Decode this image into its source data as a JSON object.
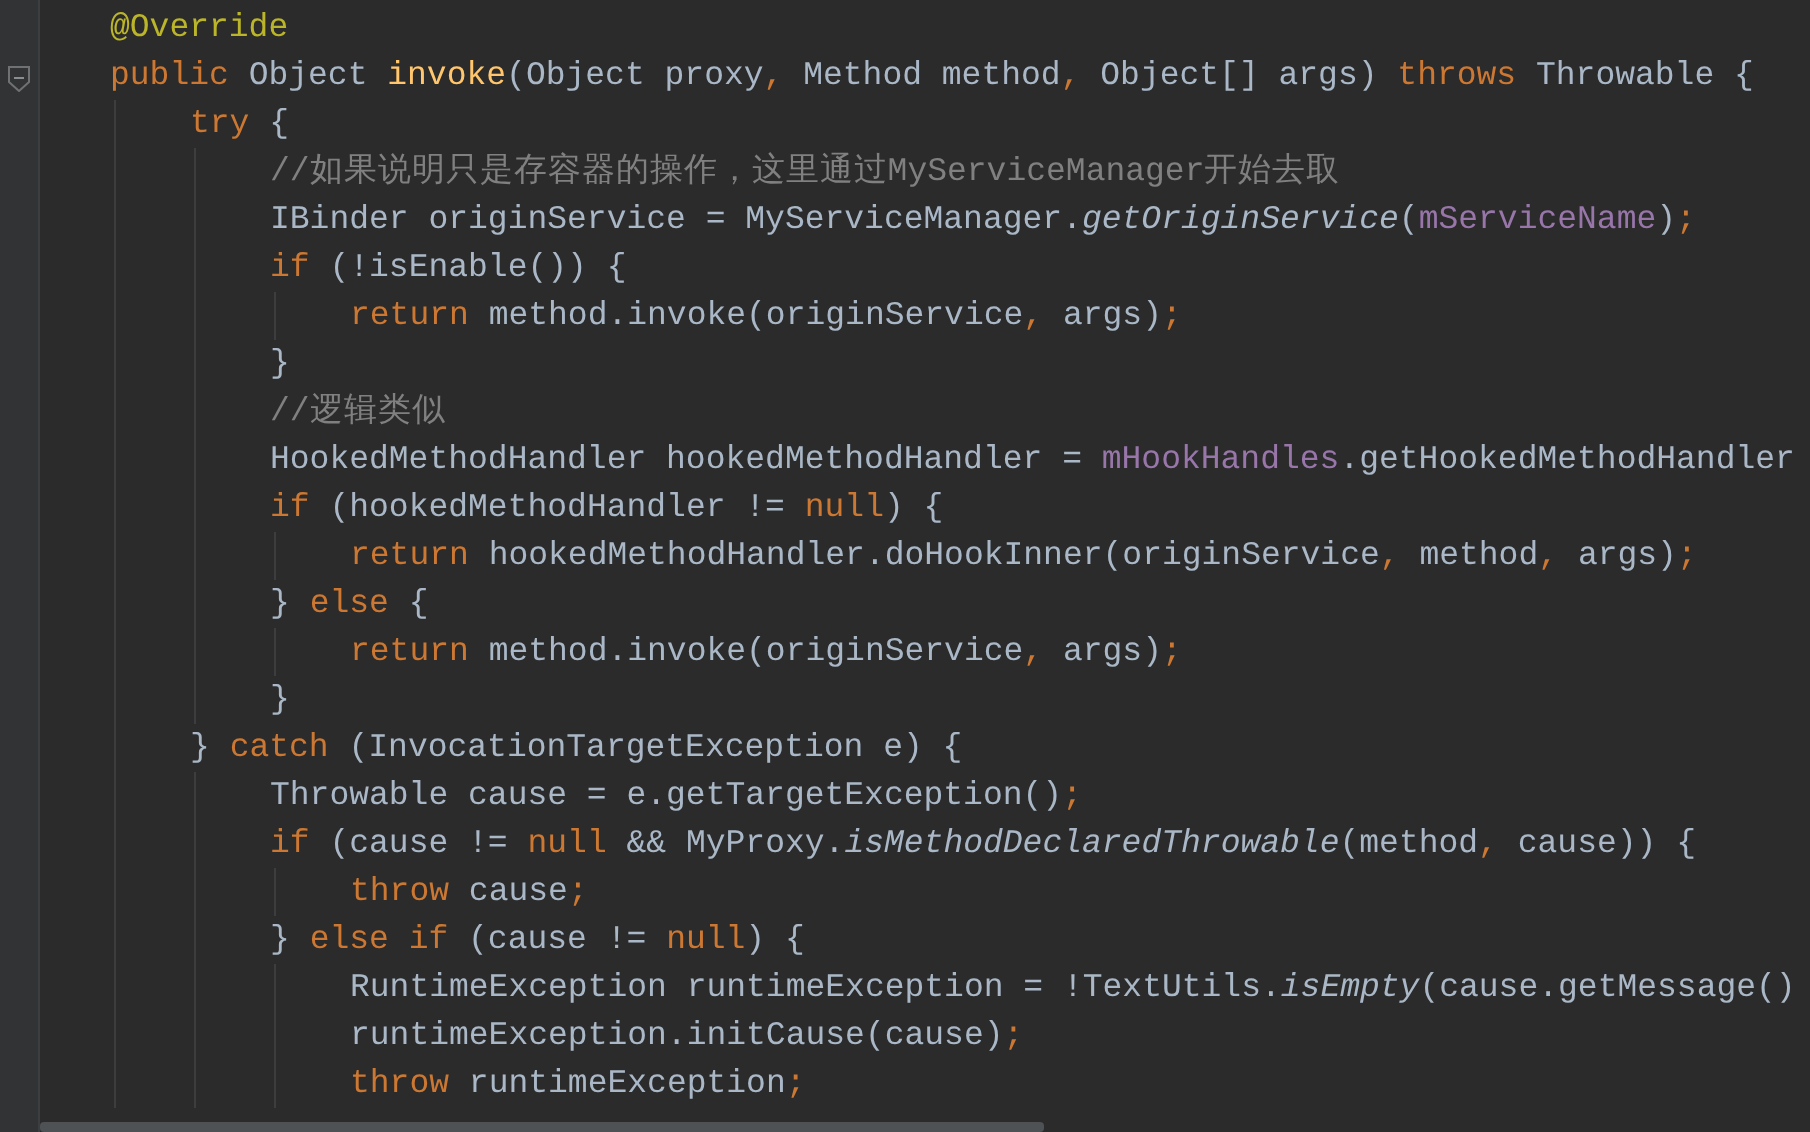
{
  "editor": {
    "lines": [
      {
        "tokens": [
          {
            "kind": "annotation",
            "text": "@Override"
          }
        ]
      },
      {
        "tokens": [
          {
            "kind": "keyword",
            "text": "public "
          },
          {
            "kind": "plain",
            "text": "Object "
          },
          {
            "kind": "declaration",
            "text": "invoke"
          },
          {
            "kind": "plain",
            "text": "(Object proxy"
          },
          {
            "kind": "punct",
            "text": ", "
          },
          {
            "kind": "plain",
            "text": "Method method"
          },
          {
            "kind": "punct",
            "text": ", "
          },
          {
            "kind": "plain",
            "text": "Object[] args) "
          },
          {
            "kind": "keyword",
            "text": "throws "
          },
          {
            "kind": "plain",
            "text": "Throwable {"
          }
        ],
        "children": [
          {
            "tokens": [
              {
                "kind": "keyword",
                "text": "try "
              },
              {
                "kind": "plain",
                "text": "{"
              }
            ],
            "children": [
              {
                "tokens": [
                  {
                    "kind": "comment",
                    "text": "//如果说明只是存容器的操作，这里通过MyServiceManager开始去取"
                  }
                ]
              },
              {
                "tokens": [
                  {
                    "kind": "plain",
                    "text": "IBinder originService = MyServiceManager."
                  },
                  {
                    "kind": "static",
                    "text": "getOriginService"
                  },
                  {
                    "kind": "plain",
                    "text": "("
                  },
                  {
                    "kind": "field",
                    "text": "mServiceName"
                  },
                  {
                    "kind": "plain",
                    "text": ")"
                  },
                  {
                    "kind": "punct",
                    "text": ";"
                  }
                ]
              },
              {
                "tokens": [
                  {
                    "kind": "keyword",
                    "text": "if "
                  },
                  {
                    "kind": "plain",
                    "text": "(!isEnable()) {"
                  }
                ],
                "children": [
                  {
                    "tokens": [
                      {
                        "kind": "keyword",
                        "text": "return "
                      },
                      {
                        "kind": "plain",
                        "text": "method.invoke(originService"
                      },
                      {
                        "kind": "punct",
                        "text": ", "
                      },
                      {
                        "kind": "plain",
                        "text": "args)"
                      },
                      {
                        "kind": "punct",
                        "text": ";"
                      }
                    ]
                  }
                ]
              },
              {
                "tokens": [
                  {
                    "kind": "plain",
                    "text": "}"
                  }
                ]
              },
              {
                "tokens": [
                  {
                    "kind": "comment",
                    "text": "//逻辑类似"
                  }
                ]
              },
              {
                "tokens": [
                  {
                    "kind": "plain",
                    "text": "HookedMethodHandler hookedMethodHandler = "
                  },
                  {
                    "kind": "field",
                    "text": "mHookHandles"
                  },
                  {
                    "kind": "plain",
                    "text": ".getHookedMethodHandler"
                  }
                ]
              },
              {
                "tokens": [
                  {
                    "kind": "keyword",
                    "text": "if "
                  },
                  {
                    "kind": "plain",
                    "text": "(hookedMethodHandler != "
                  },
                  {
                    "kind": "keyword",
                    "text": "null"
                  },
                  {
                    "kind": "plain",
                    "text": ") {"
                  }
                ],
                "children": [
                  {
                    "tokens": [
                      {
                        "kind": "keyword",
                        "text": "return "
                      },
                      {
                        "kind": "plain",
                        "text": "hookedMethodHandler.doHookInner(originService"
                      },
                      {
                        "kind": "punct",
                        "text": ", "
                      },
                      {
                        "kind": "plain",
                        "text": "method"
                      },
                      {
                        "kind": "punct",
                        "text": ", "
                      },
                      {
                        "kind": "plain",
                        "text": "args)"
                      },
                      {
                        "kind": "punct",
                        "text": ";"
                      }
                    ]
                  }
                ]
              },
              {
                "tokens": [
                  {
                    "kind": "plain",
                    "text": "} "
                  },
                  {
                    "kind": "keyword",
                    "text": "else "
                  },
                  {
                    "kind": "plain",
                    "text": "{"
                  }
                ],
                "children": [
                  {
                    "tokens": [
                      {
                        "kind": "keyword",
                        "text": "return "
                      },
                      {
                        "kind": "plain",
                        "text": "method.invoke(originService"
                      },
                      {
                        "kind": "punct",
                        "text": ", "
                      },
                      {
                        "kind": "plain",
                        "text": "args)"
                      },
                      {
                        "kind": "punct",
                        "text": ";"
                      }
                    ]
                  }
                ]
              },
              {
                "tokens": [
                  {
                    "kind": "plain",
                    "text": "}"
                  }
                ]
              }
            ]
          },
          {
            "tokens": [
              {
                "kind": "plain",
                "text": "} "
              },
              {
                "kind": "keyword",
                "text": "catch "
              },
              {
                "kind": "plain",
                "text": "(InvocationTargetException e) {"
              }
            ],
            "children": [
              {
                "tokens": [
                  {
                    "kind": "plain",
                    "text": "Throwable cause = e.getTargetException()"
                  },
                  {
                    "kind": "punct",
                    "text": ";"
                  }
                ]
              },
              {
                "tokens": [
                  {
                    "kind": "keyword",
                    "text": "if "
                  },
                  {
                    "kind": "plain",
                    "text": "(cause != "
                  },
                  {
                    "kind": "keyword",
                    "text": "null "
                  },
                  {
                    "kind": "plain",
                    "text": "&& MyProxy."
                  },
                  {
                    "kind": "static",
                    "text": "isMethodDeclaredThrowable"
                  },
                  {
                    "kind": "plain",
                    "text": "(method"
                  },
                  {
                    "kind": "punct",
                    "text": ", "
                  },
                  {
                    "kind": "plain",
                    "text": "cause)) {"
                  }
                ],
                "children": [
                  {
                    "tokens": [
                      {
                        "kind": "keyword",
                        "text": "throw "
                      },
                      {
                        "kind": "plain",
                        "text": "cause"
                      },
                      {
                        "kind": "punct",
                        "text": ";"
                      }
                    ]
                  }
                ]
              },
              {
                "tokens": [
                  {
                    "kind": "plain",
                    "text": "} "
                  },
                  {
                    "kind": "keyword",
                    "text": "else if "
                  },
                  {
                    "kind": "plain",
                    "text": "(cause != "
                  },
                  {
                    "kind": "keyword",
                    "text": "null"
                  },
                  {
                    "kind": "plain",
                    "text": ") {"
                  }
                ],
                "children": [
                  {
                    "tokens": [
                      {
                        "kind": "plain",
                        "text": "RuntimeException runtimeException = !TextUtils."
                      },
                      {
                        "kind": "static",
                        "text": "isEmpty"
                      },
                      {
                        "kind": "plain",
                        "text": "(cause.getMessage()"
                      }
                    ]
                  },
                  {
                    "tokens": [
                      {
                        "kind": "plain",
                        "text": "runtimeException.initCause(cause)"
                      },
                      {
                        "kind": "punct",
                        "text": ";"
                      }
                    ]
                  },
                  {
                    "tokens": [
                      {
                        "kind": "keyword",
                        "text": "throw "
                      },
                      {
                        "kind": "plain",
                        "text": "runtimeException"
                      },
                      {
                        "kind": "punct",
                        "text": ";"
                      }
                    ]
                  }
                ]
              }
            ]
          }
        ]
      }
    ]
  }
}
